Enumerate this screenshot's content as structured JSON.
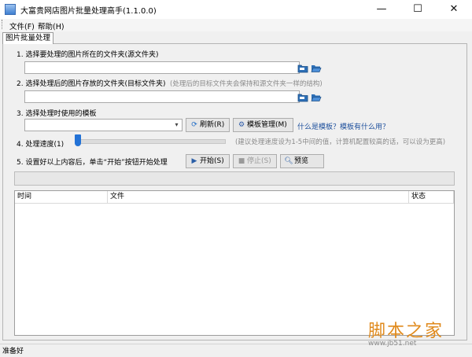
{
  "window": {
    "title": "大富贵网店图片批量处理高手(1.1.0.0)",
    "minimize_glyph": "—",
    "maximize_glyph": "☐",
    "close_glyph": "✕"
  },
  "menu": {
    "file": "文件(F)",
    "help": "帮助(H)"
  },
  "tab": {
    "label": "图片批量处理"
  },
  "step1": {
    "label": "1. 选择要处理的图片所在的文件夹(源文件夹)",
    "value": ""
  },
  "step2": {
    "label": "2. 选择处理后的图片存放的文件夹(目标文件夹)",
    "hint": "(处理后的目标文件夹会保持和源文件夹一样的结构)",
    "value": ""
  },
  "step3": {
    "label": "3. 选择处理时使用的模板",
    "selected": "",
    "refresh_button": "刷新(R)",
    "manage_button": "模板管理(M)",
    "help_link": "什么是模板？模板有什么用？"
  },
  "step4": {
    "label": "4. 处理速度(1)",
    "speed_level": 1,
    "hint": "(建议处理速度设为1-5中间的值，计算机配置较高的话，可以设为更高)"
  },
  "step5": {
    "label": "5. 设置好以上内容后，单击“开始”按钮开始处理",
    "start_button": "开始(S)",
    "stop_button": "停止(S)",
    "preview_button": "预览"
  },
  "progress": 0,
  "table": {
    "columns": [
      "时间",
      "文件",
      "状态"
    ],
    "rows": []
  },
  "status": {
    "text": "准备好"
  },
  "watermark": {
    "brand": "脚本之家",
    "url": "www.jb51.net"
  },
  "icons": {
    "folder": "folder-icon",
    "open_folder": "open-folder-icon",
    "refresh": "refresh-icon",
    "gear": "gear-icon",
    "play": "play-icon",
    "stop": "stop-icon",
    "search": "search-icon",
    "chevron": "chevron-down-icon"
  },
  "colors": {
    "accent": "#2372d6",
    "link": "#1d4f9c",
    "watermark": "#e08a1c"
  }
}
